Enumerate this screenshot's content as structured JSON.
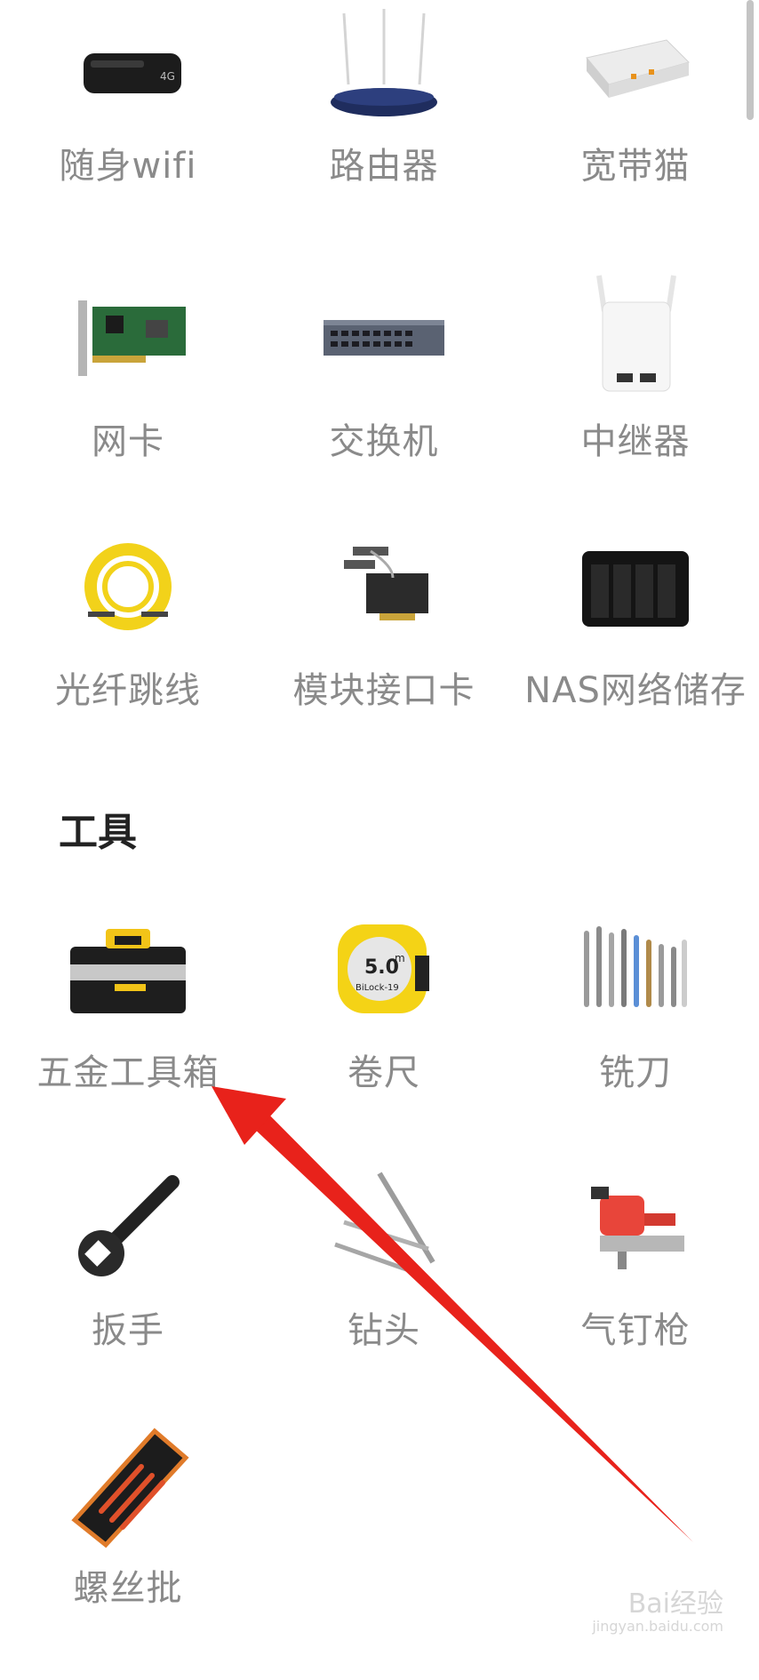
{
  "networking": {
    "items": [
      {
        "label": "随身wifi",
        "icon": "usb-wifi-dongle-icon"
      },
      {
        "label": "路由器",
        "icon": "router-icon"
      },
      {
        "label": "宽带猫",
        "icon": "modem-icon"
      },
      {
        "label": "网卡",
        "icon": "network-card-icon"
      },
      {
        "label": "交换机",
        "icon": "switch-icon"
      },
      {
        "label": "中继器",
        "icon": "repeater-icon"
      },
      {
        "label": "光纤跳线",
        "icon": "fiber-cable-icon"
      },
      {
        "label": "模块接口卡",
        "icon": "interface-card-icon"
      },
      {
        "label": "NAS网络储存",
        "icon": "nas-icon"
      }
    ]
  },
  "tools": {
    "title": "工具",
    "items": [
      {
        "label": "五金工具箱",
        "icon": "toolbox-icon"
      },
      {
        "label": "卷尺",
        "icon": "tape-measure-icon"
      },
      {
        "label": "铣刀",
        "icon": "milling-cutter-icon"
      },
      {
        "label": "扳手",
        "icon": "wrench-icon"
      },
      {
        "label": "钻头",
        "icon": "drill-bit-icon"
      },
      {
        "label": "气钉枪",
        "icon": "nail-gun-icon"
      },
      {
        "label": "螺丝批",
        "icon": "screwdriver-set-icon"
      }
    ]
  },
  "tape_measure_text": {
    "size": "5.0",
    "unit": "m",
    "brand": "BiLock-19"
  },
  "modem_mark": "4G",
  "watermark": {
    "brand": "Bai经验",
    "url": "jingyan.baidu.com"
  },
  "colors": {
    "label": "#8a8a8a",
    "title": "#222222",
    "arrow": "#e8221b"
  }
}
